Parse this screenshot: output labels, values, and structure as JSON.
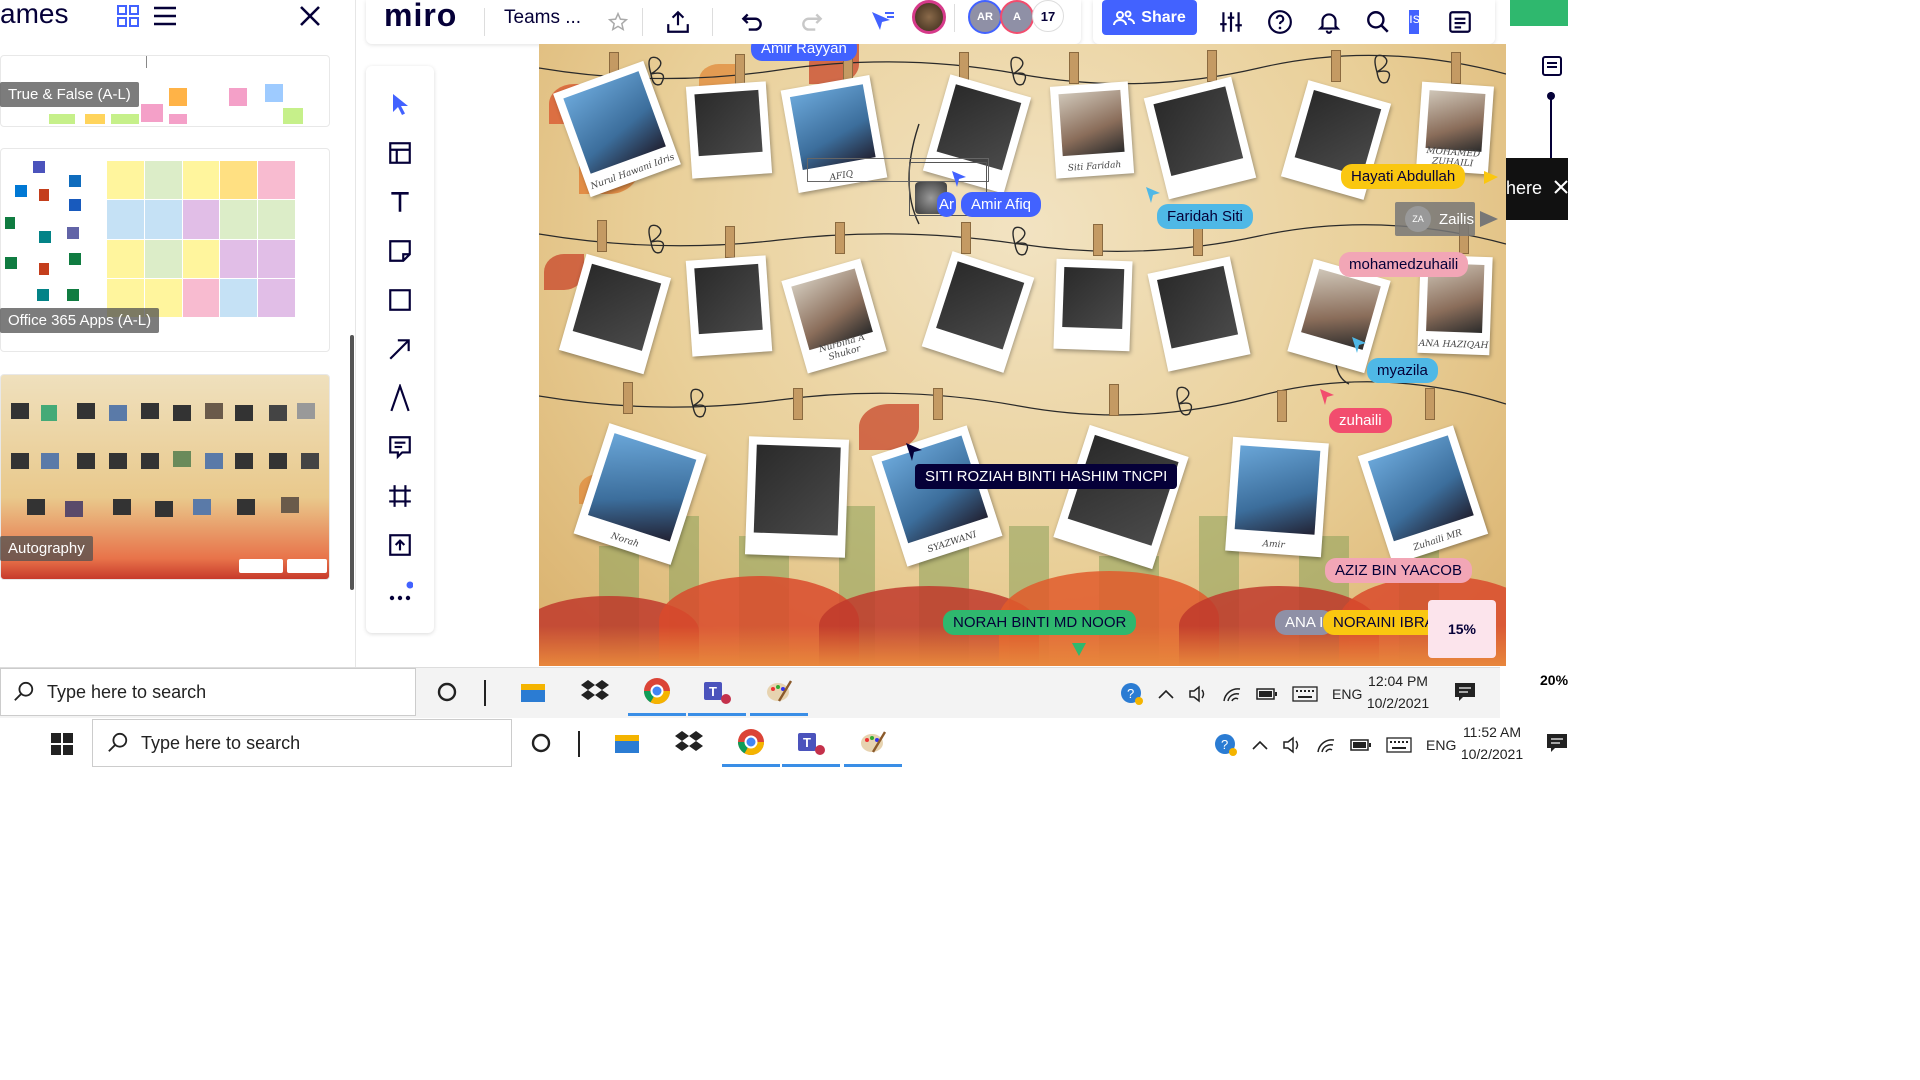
{
  "left_panel": {
    "title": "ames",
    "thumbnails": [
      {
        "label": "True & False (A-L)"
      },
      {
        "label": "Office 365 Apps (A-L)"
      },
      {
        "label": "Autography"
      }
    ]
  },
  "topbar": {
    "logo": "miro",
    "board_name": "Teams ...",
    "collaborator_count": "17",
    "avatars": [
      {
        "initials": "AR"
      },
      {
        "initials": "A"
      }
    ],
    "share_label": "Share",
    "partial_tab": "ıs"
  },
  "board": {
    "photo_captions": [
      "Nurul Hawani Idris",
      "AFIQ",
      "Siti Faridah",
      "Nurbiha A Shukor",
      "ANA HAZIQAH",
      "Norah",
      "SYAZWANI",
      "Amir",
      "Zuhaili MR",
      "MOHAMED ZUHAILI"
    ],
    "cursor_labels": [
      {
        "text": "Amir Rayyan",
        "color": "#4262ff"
      },
      {
        "text": "Amir Afiq",
        "color": "#4262ff"
      },
      {
        "text": "Ar",
        "color": "#4262ff"
      },
      {
        "text": "Faridah Siti",
        "color": "#4fb8e6"
      },
      {
        "text": "Hayati Abdullah",
        "color": "#fac710"
      },
      {
        "text": "Zailis",
        "color": "#777777"
      },
      {
        "text": "mohamedzuhaili",
        "color": "#f2a6b6"
      },
      {
        "text": "myazila",
        "color": "#4fb8e6"
      },
      {
        "text": "zuhaili",
        "color": "#f24d6e"
      },
      {
        "text": "SITI ROZIAH BINTI HASHIM TNCPI",
        "color": "#050038"
      },
      {
        "text": "AZIZ BIN YAACOB",
        "color": "#f2a6b6"
      },
      {
        "text": "NORAH BINTI MD NOOR",
        "color": "#2fb86e"
      },
      {
        "text": "ANA I",
        "color": "#8f90a6"
      },
      {
        "text": "NORAINI IBRA",
        "color": "#fac710"
      }
    ],
    "zailis_initials": "ZA",
    "zoom": "15%"
  },
  "right": {
    "partial_text": "here",
    "zoom": "20%"
  },
  "taskbar_inner": {
    "search_placeholder": "Type here to search",
    "lang": "ENG",
    "time": "12:04 PM",
    "date": "10/2/2021"
  },
  "taskbar_outer": {
    "search_placeholder": "Type here to search",
    "lang": "ENG",
    "time": "11:52 AM",
    "date": "10/2/2021"
  }
}
